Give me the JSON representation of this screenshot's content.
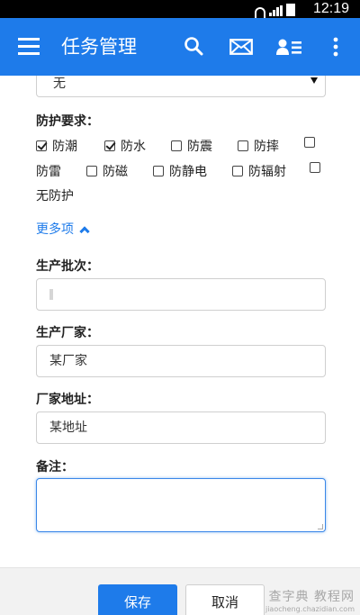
{
  "status_bar": {
    "time": "12:19"
  },
  "app_bar": {
    "title": "任务管理"
  },
  "form": {
    "top_select": {
      "value": "无"
    },
    "protection": {
      "label": "防护要求：",
      "options": [
        {
          "label": "防潮",
          "checked": true
        },
        {
          "label": "防水",
          "checked": true
        },
        {
          "label": "防震",
          "checked": false
        },
        {
          "label": "防摔",
          "checked": false
        },
        {
          "label": "防雷",
          "checked": false
        },
        {
          "label": "防磁",
          "checked": false
        },
        {
          "label": "防静电",
          "checked": false
        },
        {
          "label": "防辐射",
          "checked": false
        },
        {
          "label": "无防护",
          "checked": false
        }
      ]
    },
    "more_toggle": "更多项",
    "batch": {
      "label": "生产批次：",
      "value": ""
    },
    "manufacturer": {
      "label": "生产厂家：",
      "value": "某厂家"
    },
    "address": {
      "label": "厂家地址：",
      "value": "某地址"
    },
    "remarks": {
      "label": "备注：",
      "value": ""
    }
  },
  "footer": {
    "save_label": "保存",
    "cancel_label": "取消"
  },
  "watermark": {
    "text": "查字典 教程网",
    "url": "jiaocheng.chazidian.com"
  }
}
